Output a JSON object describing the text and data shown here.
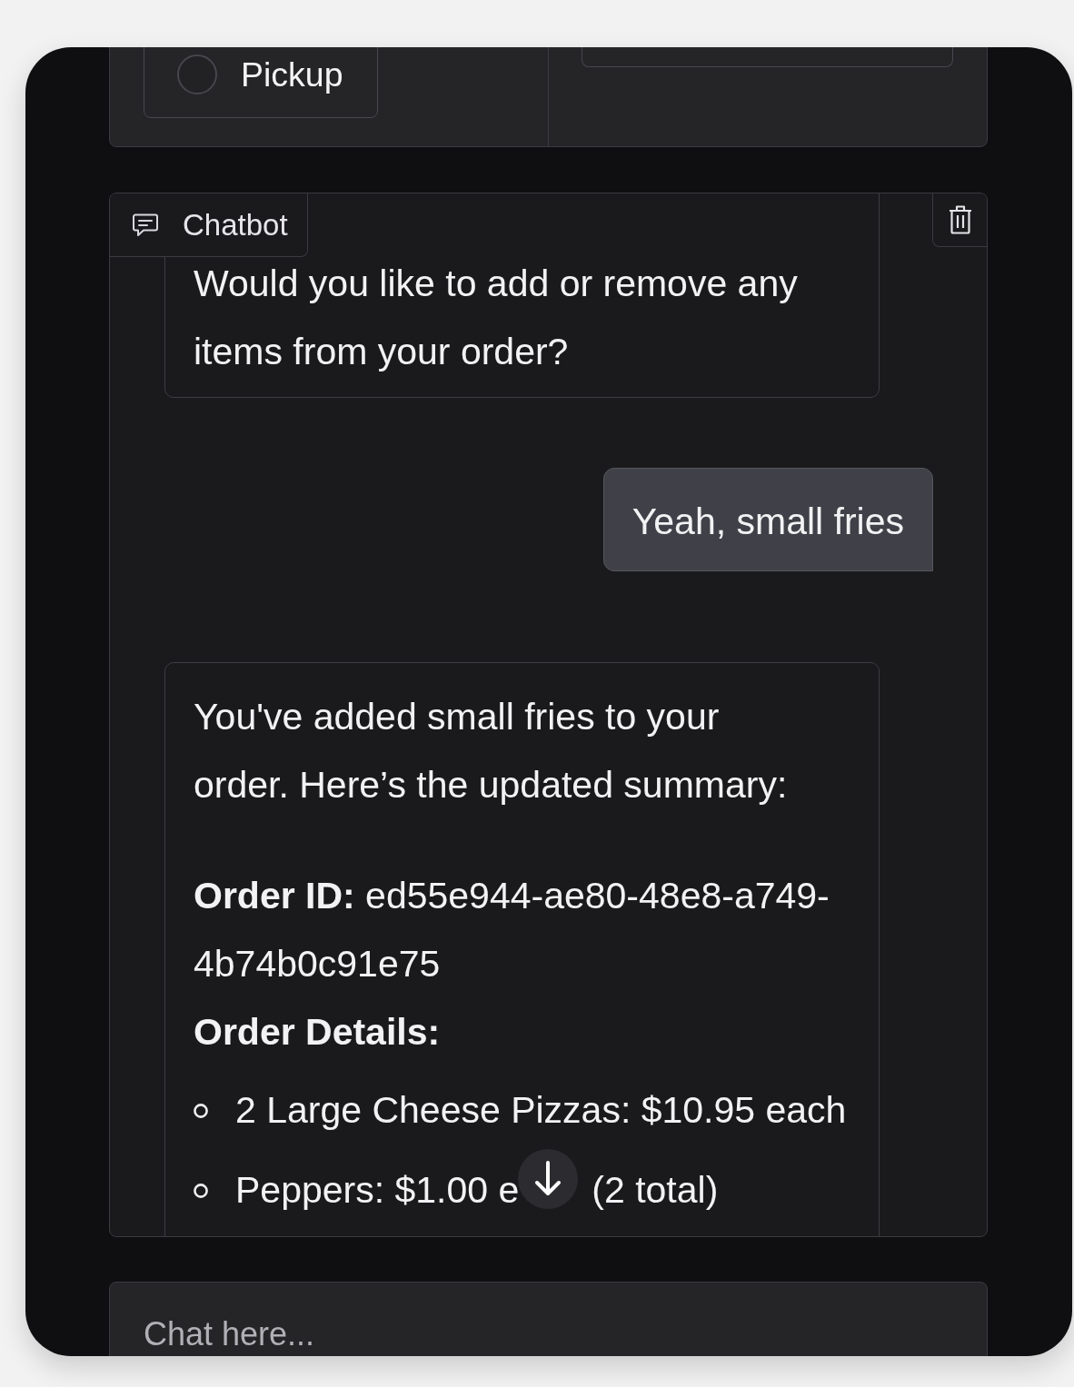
{
  "form_panel": {
    "options": [
      {
        "label": "Pickup",
        "selected": false
      }
    ]
  },
  "chatbot": {
    "label": "Chatbot",
    "messages": [
      {
        "kind": "bot",
        "blocks": [
          {
            "kind": "paragraph",
            "text": "Would you like to add or remove any items from your order?"
          }
        ]
      },
      {
        "kind": "user",
        "blocks": [
          {
            "kind": "paragraph",
            "text": "Yeah, small fries"
          }
        ]
      },
      {
        "kind": "bot",
        "blocks": [
          {
            "kind": "paragraph",
            "text": "You've added small fries to your order. Here’s the updated summary:"
          },
          {
            "kind": "line",
            "text": "**Order ID:** ed55e944-ae80-48e8-a749-4b74b0c91e75"
          },
          {
            "kind": "heading",
            "text": "Order Details:"
          },
          {
            "kind": "list",
            "items": [
              {
                "parts": [
                  "2 Large Cheese Pizzas: $10.95 each"
                ]
              },
              {
                "parts": [
                  "Peppers: $1.00 e",
                  "(2 total)"
                ]
              }
            ]
          }
        ]
      }
    ]
  },
  "input": {
    "placeholder": "Chat here..."
  }
}
